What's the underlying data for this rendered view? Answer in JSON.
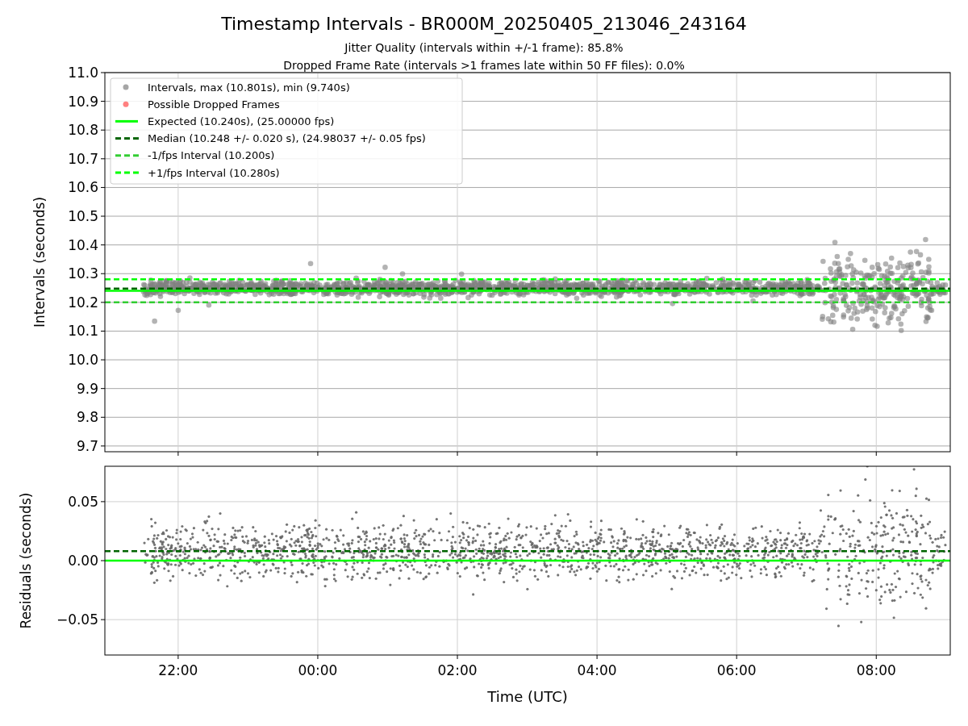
{
  "figure": {
    "title": "Timestamp Intervals - BR000M_20250405_213046_243164",
    "subtitles": [
      "Jitter Quality (intervals within +/-1 frame): 85.8%",
      "Dropped Frame Rate (intervals >1 frames late within 50 FF files): 0.0%"
    ]
  },
  "legend": [
    {
      "kind": "marker",
      "label": "Intervals, max (10.801s), min (9.740s)",
      "color": "#a6a6a6"
    },
    {
      "kind": "marker",
      "label": "Possible Dropped Frames",
      "color": "#ff8080"
    },
    {
      "kind": "solid",
      "label": "Expected (10.240s), (25.00000 fps)",
      "color": "#00ff00"
    },
    {
      "kind": "dashed",
      "label": "Median (10.248 +/- 0.020 s), (24.98037 +/- 0.05 fps)",
      "color": "#006400"
    },
    {
      "kind": "dashed",
      "label": "-1/fps Interval (10.200s)",
      "color": "#32cd32"
    },
    {
      "kind": "dashed",
      "label": "+1/fps Interval (10.280s)",
      "color": "#00ff00"
    }
  ],
  "plots": [
    {
      "ylabel": "Intervals (seconds)",
      "yticks": [
        "11.0",
        "10.9",
        "10.8",
        "10.7",
        "10.6",
        "10.5",
        "10.4",
        "10.3",
        "10.2",
        "10.1",
        "10.0",
        "9.9",
        "9.8",
        "9.7"
      ]
    },
    {
      "ylabel": "Residuals (seconds)",
      "yticks": [
        "0.05",
        "0.00",
        "−0.05"
      ],
      "xticks": [
        "22:00",
        "00:00",
        "02:00",
        "04:00",
        "06:00",
        "08:00"
      ],
      "xlabel": "Time (UTC)"
    }
  ]
}
